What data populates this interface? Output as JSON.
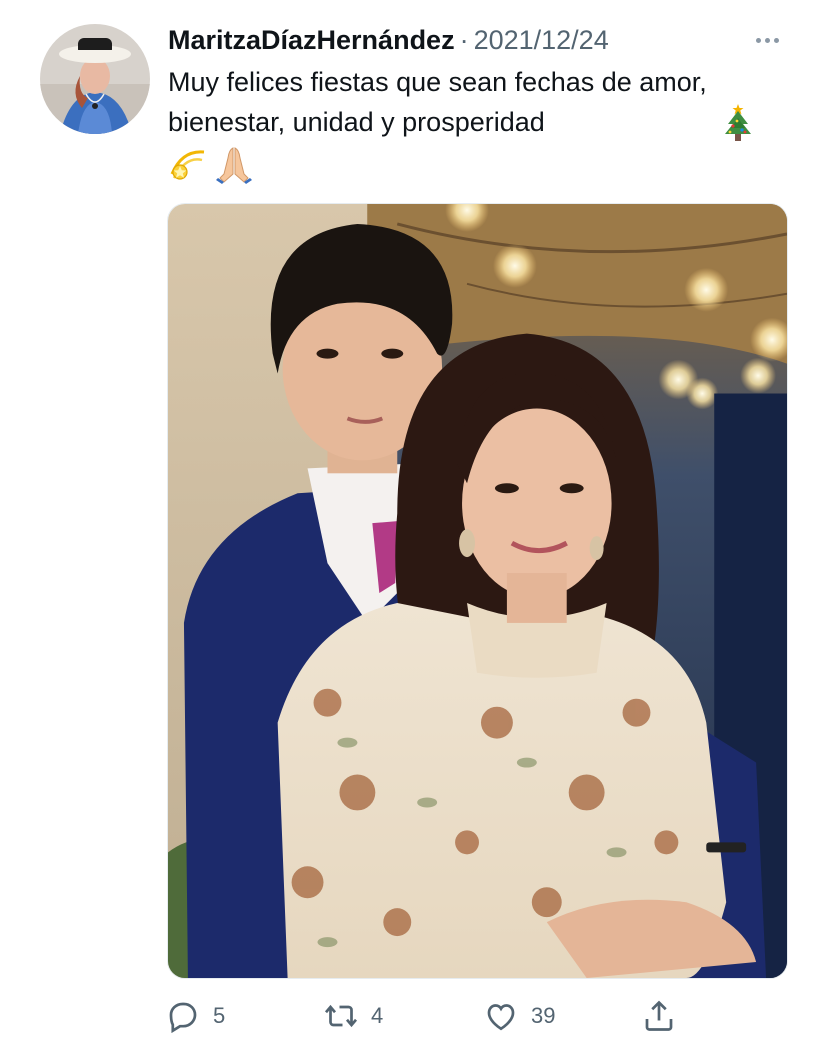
{
  "tweet": {
    "author": "MaritzaDíazHernández",
    "separator": "·",
    "date": "2021/12/24",
    "text": "Muy felices fiestas que sean fechas de amor, bienestar, unidad y prosperidad",
    "emojis": [
      "christmas-tree",
      "dizzy-star",
      "folded-hands"
    ]
  },
  "actions": {
    "replies": "5",
    "retweets": "4",
    "likes": "39"
  },
  "colors": {
    "text": "#0f1419",
    "muted": "#536471",
    "border": "#e6ecf0"
  }
}
